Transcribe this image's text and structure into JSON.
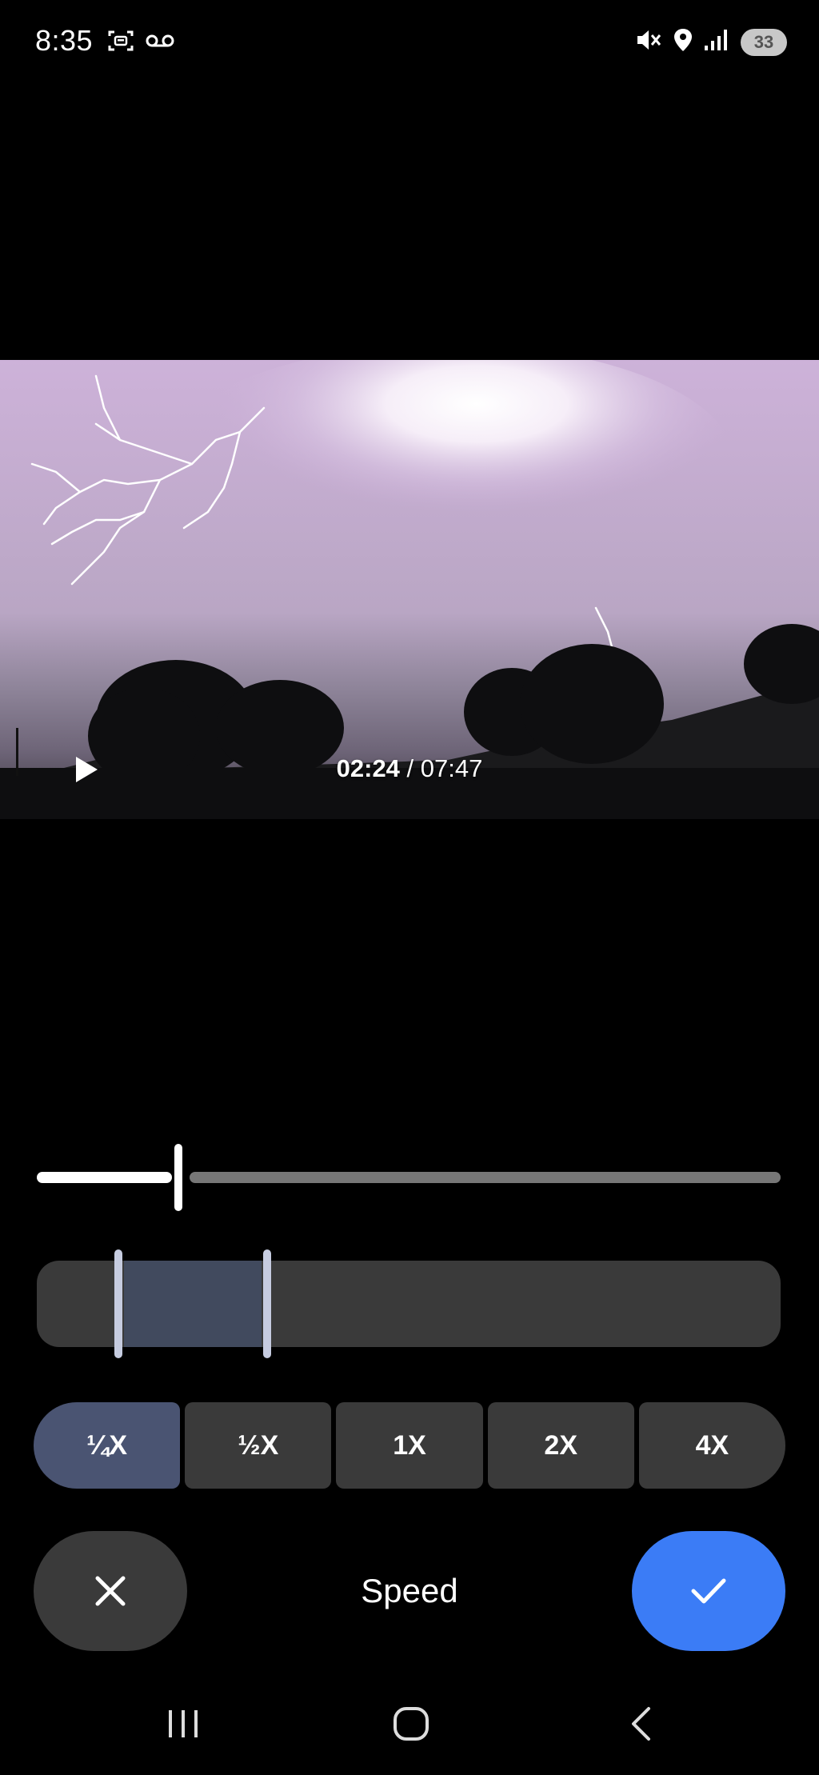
{
  "status_bar": {
    "time": "8:35",
    "left_icons": [
      "screenshot-icon",
      "voicemail-icon"
    ],
    "right_icons": [
      "mute-vibrate-icon",
      "location-icon",
      "signal-icon"
    ],
    "battery": "33"
  },
  "video": {
    "current_time": "02:24",
    "separator": " / ",
    "total_time": "07:47",
    "playing": false
  },
  "scrubber": {
    "progress": 0.19
  },
  "range": {
    "start": 0.11,
    "end": 0.31
  },
  "speed_options": [
    {
      "label": "¼X",
      "selected": true
    },
    {
      "label": "½X",
      "selected": false
    },
    {
      "label": "1X",
      "selected": false
    },
    {
      "label": "2X",
      "selected": false
    },
    {
      "label": "4X",
      "selected": false
    }
  ],
  "action_bar": {
    "title": "Speed",
    "cancel_icon": "close-icon",
    "confirm_icon": "check-icon"
  },
  "nav_bar": {
    "icons": [
      "recents-icon",
      "home-icon",
      "back-icon"
    ]
  },
  "colors": {
    "accent": "#3b7cf6",
    "selected_speed": "#4a5472",
    "button_bg": "#3a3a3a"
  }
}
